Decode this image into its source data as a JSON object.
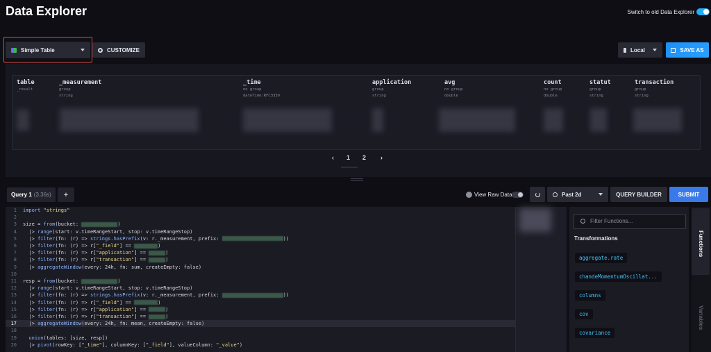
{
  "header": {
    "title": "Data Explorer",
    "switch_label": "Switch to old Data Explorer"
  },
  "toolbar": {
    "viz_type": "Simple Table",
    "customize": "CUSTOMIZE",
    "timezone": "Local",
    "save_as": "SAVE AS"
  },
  "table": {
    "columns": [
      {
        "name": "table",
        "sub1": "_result",
        "sub2": ""
      },
      {
        "name": "_measurement",
        "sub1": "group",
        "sub2": "string"
      },
      {
        "name": "_time",
        "sub1": "no group",
        "sub2": "dateTime:RFC3339"
      },
      {
        "name": "application",
        "sub1": "group",
        "sub2": "string"
      },
      {
        "name": "avg",
        "sub1": "no group",
        "sub2": "double"
      },
      {
        "name": "count",
        "sub1": "no group",
        "sub2": "double"
      },
      {
        "name": "statut",
        "sub1": "group",
        "sub2": "string"
      },
      {
        "name": "transaction",
        "sub1": "group",
        "sub2": "string"
      }
    ],
    "pager": {
      "prev": "‹",
      "pages": [
        "1",
        "2"
      ],
      "next": "›"
    }
  },
  "query": {
    "tab_label": "Query 1",
    "tab_duration": "(3.36s)",
    "add_tab": "+",
    "view_raw": "View Raw Data",
    "time_range": "Past 2d",
    "query_builder": "QUERY BUILDER",
    "submit": "SUBMIT"
  },
  "editor": {
    "lines": [
      {
        "n": "1",
        "code": "import \"strings\""
      },
      {
        "n": "2",
        "code": ""
      },
      {
        "n": "3",
        "code": "size = from(bucket: ",
        "tail": ")"
      },
      {
        "n": "4",
        "code": "  |> range(start: v.timeRangeStart, stop: v.timeRangeStop)"
      },
      {
        "n": "5",
        "code": "  |> filter(fn: (r) => strings.hasPrefix(v: r._measurement, prefix: ",
        "tail": "))"
      },
      {
        "n": "6",
        "code": "  |> filter(fn: (r) => r[\"_field\"] == ",
        "tail": ")"
      },
      {
        "n": "7",
        "code": "  |> filter(fn: (r) => r[\"application\"] == ",
        "tail": ")"
      },
      {
        "n": "8",
        "code": "  |> filter(fn: (r) => r[\"transaction\"] == ",
        "tail": ")"
      },
      {
        "n": "9",
        "code": "  |> aggregateWindow(every: 24h, fn: sum, createEmpty: false)"
      },
      {
        "n": "10",
        "code": ""
      },
      {
        "n": "11",
        "code": "resp = from(bucket: ",
        "tail": ")"
      },
      {
        "n": "12",
        "code": "  |> range(start: v.timeRangeStart, stop: v.timeRangeStop)"
      },
      {
        "n": "13",
        "code": "  |> filter(fn: (r) => strings.hasPrefix(v: r._measurement, prefix: ",
        "tail": "))"
      },
      {
        "n": "14",
        "code": "  |> filter(fn: (r) => r[\"_field\"] == ",
        "tail": ")"
      },
      {
        "n": "15",
        "code": "  |> filter(fn: (r) => r[\"application\"] == ",
        "tail": ")"
      },
      {
        "n": "16",
        "code": "  |> filter(fn: (r) => r[\"transaction\"] == ",
        "tail": ")"
      },
      {
        "n": "17",
        "code": "  |> aggregateWindow(every: 24h, fn: mean, createEmpty: false)"
      },
      {
        "n": "18",
        "code": ""
      },
      {
        "n": "19",
        "code": "  union(tables: [size, resp])"
      },
      {
        "n": "20",
        "code": "  |> pivot(rowKey: [\"_time\"], columnKey: [\"_field\"], valueColumn: \"_value\")"
      }
    ]
  },
  "functions": {
    "search_placeholder": "Filter Functions...",
    "heading": "Transformations",
    "items": [
      "aggregate.rate",
      "chandeMomentumOscillat...",
      "columns",
      "cov",
      "covariance"
    ],
    "side_tabs": [
      "Functions",
      "Variables"
    ]
  }
}
